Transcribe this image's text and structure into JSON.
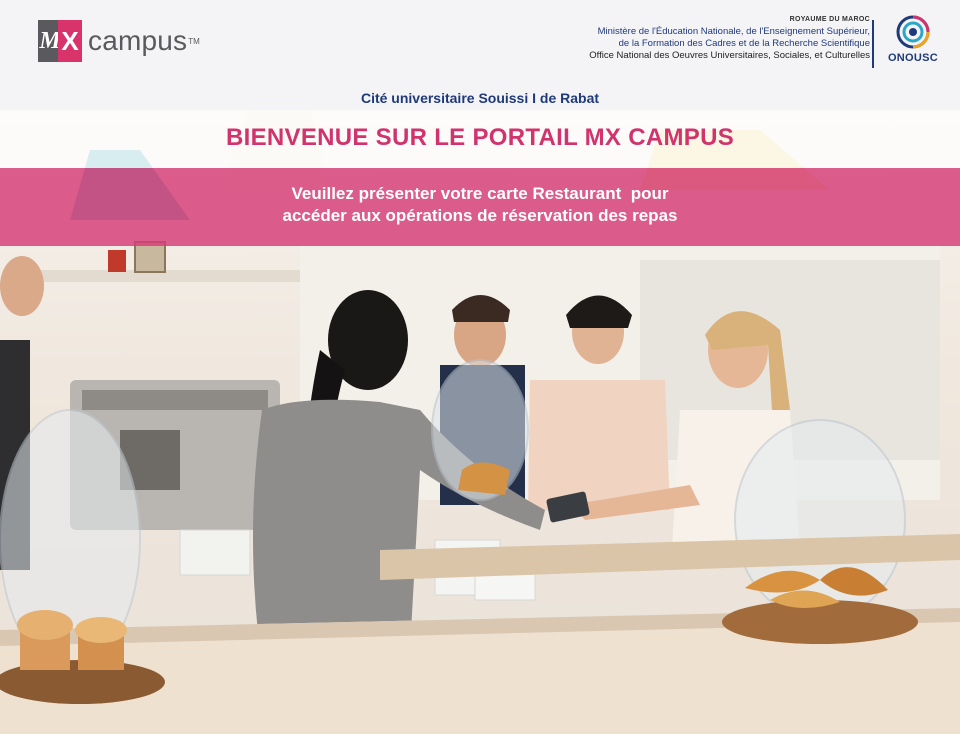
{
  "header": {
    "logo": {
      "mark": "MX",
      "word": "campus",
      "tm": "TM"
    },
    "ministry": {
      "royaume": "ROYAUME DU MAROC",
      "line1": "Ministère de l'Éducation Nationale, de l'Enseignement Supérieur,",
      "line2": "de la Formation des Cadres et de la Recherche Scientifique",
      "line3": "Office National des Oeuvres Universitaires, Sociales, et Culturelles"
    },
    "onousc_label": "ONOUSC",
    "cite": "Cité universitaire Souissi I de Rabat"
  },
  "hero": {
    "welcome": "BIENVENUE SUR LE PORTAIL MX CAMPUS",
    "instruction_line1": "Veuillez présenter votre carte Restaurant  pour",
    "instruction_line2": "accéder aux opérations de réservation des repas",
    "photo_subject": "café counter with customers paying by card"
  },
  "colors": {
    "brand_pink": "#d1336c",
    "navy": "#1f3a7a",
    "mark_grey": "#5a5a5e"
  }
}
